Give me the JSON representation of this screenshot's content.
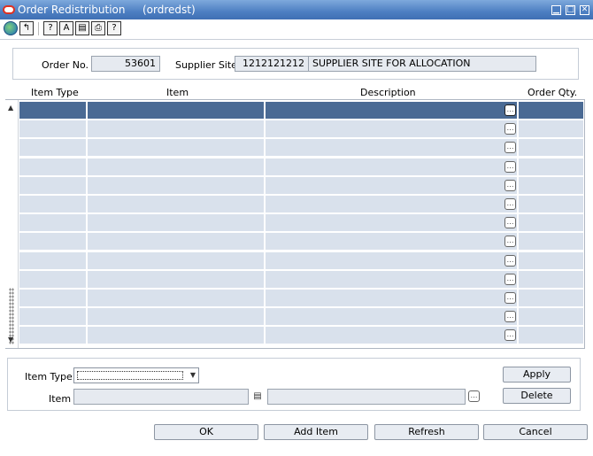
{
  "window": {
    "title": "Order Redistribution",
    "subtitle": "(ordredst)",
    "controls": {
      "minimize": "▁",
      "maximize": "□",
      "close": "✕"
    }
  },
  "toolbar": {
    "icons": [
      "globe-icon",
      "exit-icon",
      "help-icon",
      "spell-icon",
      "form-icon",
      "print-icon",
      "question-icon"
    ],
    "glyphs": {
      "exit": "↰",
      "help": "?",
      "spell": "A",
      "form": "▤",
      "print": "⎙",
      "question": "?"
    }
  },
  "header": {
    "order_no_label": "Order No.",
    "order_no_value": "53601",
    "supplier_site_label": "Supplier Site",
    "supplier_site_id": "1212121212",
    "supplier_site_name": "SUPPLIER SITE FOR ALLOCATION"
  },
  "grid": {
    "columns": [
      "Item Type",
      "Item",
      "Description",
      "Order Qty."
    ],
    "row_count": 13,
    "selected_row": 0,
    "note_glyph": "…",
    "scroll_up": "▲",
    "scroll_down": "▼"
  },
  "editor": {
    "item_type_label": "Item Type",
    "item_type_value": "",
    "item_label": "Item",
    "item_value": "",
    "item_desc_value": "",
    "lookup_glyph": "▤",
    "note_glyph": "…",
    "select_caret": "▼",
    "apply_label": "Apply",
    "delete_label": "Delete"
  },
  "footer": {
    "ok_label": "OK",
    "add_item_label": "Add Item",
    "refresh_label": "Refresh",
    "cancel_label": "Cancel"
  },
  "colors": {
    "titlebar": "#4d7fc2",
    "grid_cell": "#d9e1ec",
    "grid_selected": "#4a6a94",
    "field_bg": "#e6eaf0"
  }
}
